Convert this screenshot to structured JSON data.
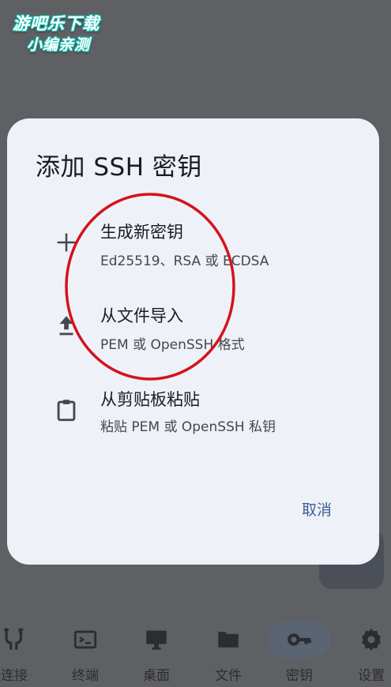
{
  "watermark": {
    "line1": "游吧乐下载",
    "line2": "小编亲测"
  },
  "dialog": {
    "title": "添加 SSH 密钥",
    "options": [
      {
        "icon": "plus-icon",
        "title": "生成新密钥",
        "subtitle": "Ed25519、RSA 或 ECDSA"
      },
      {
        "icon": "upload-icon",
        "title": "从文件导入",
        "subtitle": "PEM 或 OpenSSH 格式"
      },
      {
        "icon": "clipboard-icon",
        "title": "从剪贴板粘贴",
        "subtitle": "粘贴 PEM 或 OpenSSH 私钥"
      }
    ],
    "cancel_label": "取消"
  },
  "nav": {
    "items": [
      {
        "icon": "plug-icon",
        "label": "连接"
      },
      {
        "icon": "terminal-icon",
        "label": "终端"
      },
      {
        "icon": "monitor-icon",
        "label": "桌面"
      },
      {
        "icon": "folder-icon",
        "label": "文件"
      },
      {
        "icon": "key-icon",
        "label": "密钥",
        "selected": true
      },
      {
        "icon": "gear-icon",
        "label": "设置"
      }
    ]
  },
  "colors": {
    "scrim": "#5f6064",
    "dialog_bg": "#eef1f8",
    "accent": "#3e5f93",
    "annotation": "#d4131b"
  }
}
